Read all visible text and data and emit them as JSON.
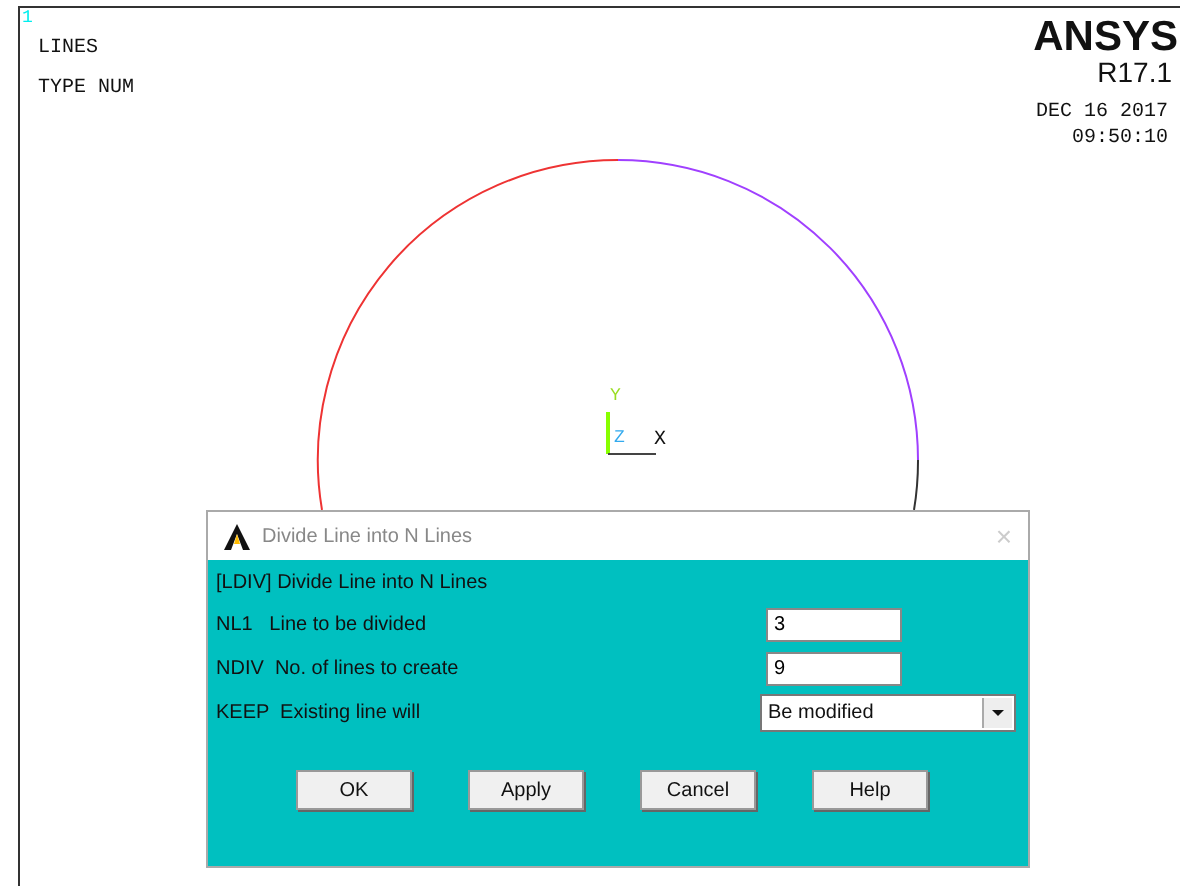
{
  "graphics": {
    "window_number": "1",
    "labels": [
      "LINES",
      "TYPE NUM"
    ],
    "brand": "ANSYS",
    "release": "R17.1",
    "date": "DEC 16 2017",
    "time": "09:50:10",
    "triad": {
      "y": "Y",
      "z": "Z",
      "x": "X"
    }
  },
  "dialog": {
    "title": "Divide Line into N Lines",
    "close": "×",
    "heading": "[LDIV]  Divide Line into N Lines",
    "fields": [
      {
        "kind": "input",
        "label": "NL1   Line to be divided",
        "value": "3"
      },
      {
        "kind": "input",
        "label": "NDIV  No. of lines to create",
        "value": "9"
      },
      {
        "kind": "select",
        "label": "KEEP  Existing line will",
        "value": "Be modified"
      }
    ],
    "buttons": [
      "OK",
      "Apply",
      "Cancel",
      "Help"
    ]
  }
}
